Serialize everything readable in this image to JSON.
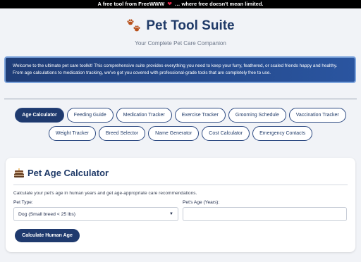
{
  "topbar": {
    "prefix": "A free tool from FreeWWW",
    "heart": "❤",
    "suffix": "… where free doesn't mean limited."
  },
  "header": {
    "title": "Pet Tool Suite",
    "subtitle": "Your Complete Pet Care Companion",
    "logo_icon": "paw-prints-icon"
  },
  "banner": {
    "text": "Welcome to the ultimate pet care toolkit! This comprehensive suite provides everything you need to keep your furry, feathered, or scaled friends happy and healthy. From age calculations to medication tracking, we've got you covered with professional-grade tools that are completely free to use."
  },
  "tabs": {
    "row1": [
      "Age Calculator",
      "Feeding Guide",
      "Medication Tracker",
      "Exercise Tracker",
      "Grooming Schedule",
      "Vaccination Tracker"
    ],
    "row2": [
      "Weight Tracker",
      "Breed Selector",
      "Name Generator",
      "Cost Calculator",
      "Emergency Contacts"
    ],
    "active": "Age Calculator"
  },
  "calculator": {
    "icon": "cake-icon",
    "title": "Pet Age Calculator",
    "description": "Calculate your pet's age in human years and get age-appropriate care recommendations.",
    "pet_type_label": "Pet Type:",
    "pet_type_value": "Dog (Small breed < 25 lbs)",
    "age_label": "Pet's Age (Years):",
    "age_value": "",
    "button_label": "Calculate Human Age"
  },
  "colors": {
    "primary": "#1f3a6e",
    "banner_start": "#1f3d77",
    "banner_end": "#2a55a0",
    "page_bg": "#f1f3f7"
  }
}
